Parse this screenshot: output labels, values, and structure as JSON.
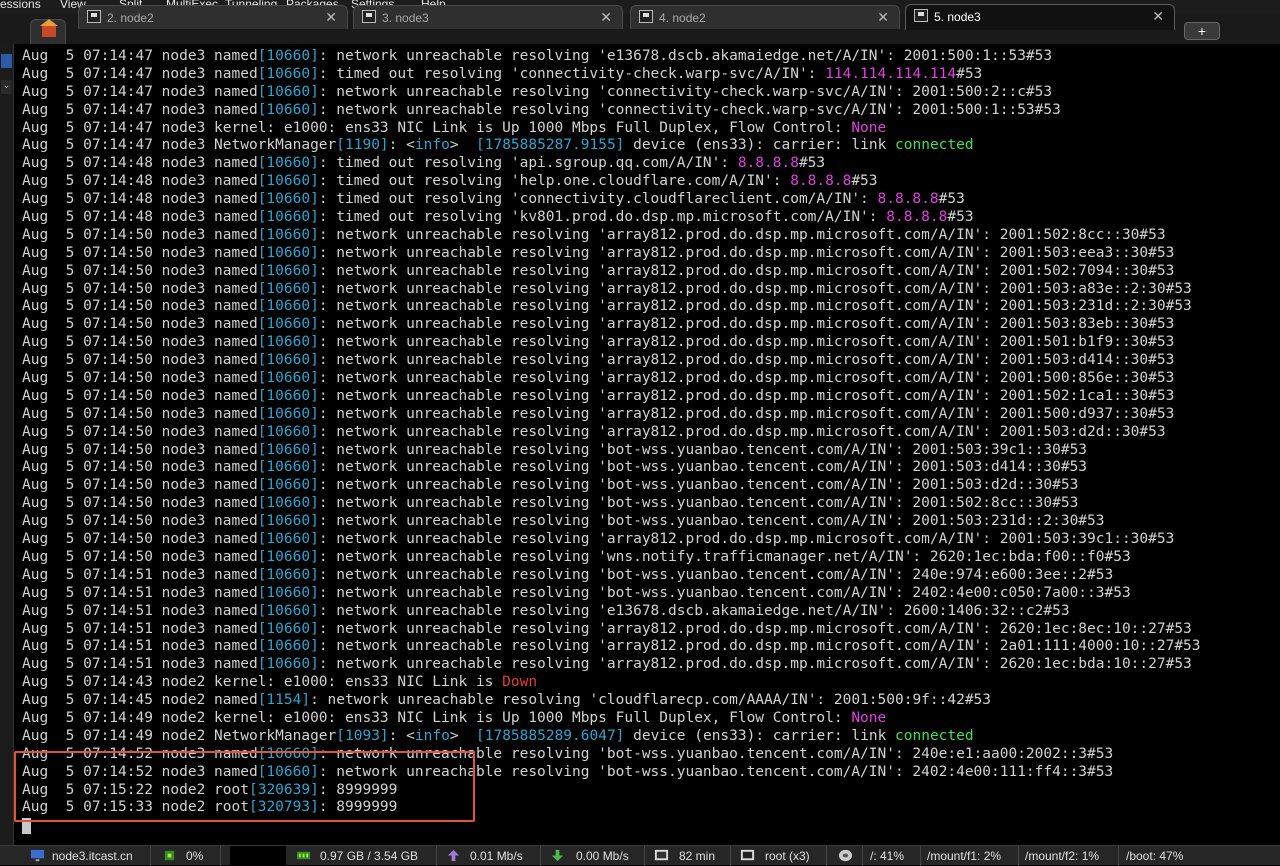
{
  "menu": [
    "essions",
    "View",
    "Split",
    "MultiExec",
    "Tunneling",
    "Packages",
    "Settings",
    "Help"
  ],
  "tabs": [
    {
      "label": "2. node2",
      "active": false
    },
    {
      "label": "3. node3",
      "active": false
    },
    {
      "label": "4. node2",
      "active": false
    },
    {
      "label": "5. node3",
      "active": true
    }
  ],
  "newtab_label": "+",
  "close_glyph": "✕",
  "colors": {
    "pid": "#2aa6d2",
    "ip": "#e040e0",
    "connected": "#3fe05a",
    "down": "#e33a3a",
    "highlight": "#e2533a",
    "text": "#d2d2d2"
  },
  "log_lines": [
    [
      [
        "Aug  5 07:14:47 node3 named",
        ""
      ],
      [
        "[10660]",
        "blue"
      ],
      [
        ": network unreachable resolving 'e13678.dscb.akamaiedge.net/A/IN': 2001:500:1::53#53",
        ""
      ]
    ],
    [
      [
        "Aug  5 07:14:47 node3 named",
        ""
      ],
      [
        "[10660]",
        "blue"
      ],
      [
        ": timed out resolving 'connectivity-check.warp-svc/A/IN': ",
        ""
      ],
      [
        "114.114.114.114",
        "mag"
      ],
      [
        "#53",
        ""
      ]
    ],
    [
      [
        "Aug  5 07:14:47 node3 named",
        ""
      ],
      [
        "[10660]",
        "blue"
      ],
      [
        ": network unreachable resolving 'connectivity-check.warp-svc/A/IN': 2001:500:2::c#53",
        ""
      ]
    ],
    [
      [
        "Aug  5 07:14:47 node3 named",
        ""
      ],
      [
        "[10660]",
        "blue"
      ],
      [
        ": network unreachable resolving 'connectivity-check.warp-svc/A/IN': 2001:500:1::53#53",
        ""
      ]
    ],
    [
      [
        "Aug  5 07:14:47 node3 kernel: e1000: ens33 NIC Link is Up 1000 Mbps Full Duplex, Flow Control: ",
        ""
      ],
      [
        "None",
        "mag"
      ]
    ],
    [
      [
        "Aug  5 07:14:47 node3 NetworkManager",
        ""
      ],
      [
        "[1190]",
        "blue"
      ],
      [
        ": <",
        ""
      ],
      [
        "info",
        "blue"
      ],
      [
        ">  ",
        ""
      ],
      [
        "[1785885287.9155]",
        "blue"
      ],
      [
        " device (ens33): carrier: link ",
        ""
      ],
      [
        "connected",
        "grn"
      ]
    ],
    [
      [
        "Aug  5 07:14:48 node3 named",
        ""
      ],
      [
        "[10660]",
        "blue"
      ],
      [
        ": timed out resolving 'api.sgroup.qq.com/A/IN': ",
        ""
      ],
      [
        "8.8.8.8",
        "mag"
      ],
      [
        "#53",
        ""
      ]
    ],
    [
      [
        "Aug  5 07:14:48 node3 named",
        ""
      ],
      [
        "[10660]",
        "blue"
      ],
      [
        ": timed out resolving 'help.one.cloudflare.com/A/IN': ",
        ""
      ],
      [
        "8.8.8.8",
        "mag"
      ],
      [
        "#53",
        ""
      ]
    ],
    [
      [
        "Aug  5 07:14:48 node3 named",
        ""
      ],
      [
        "[10660]",
        "blue"
      ],
      [
        ": timed out resolving 'connectivity.cloudflareclient.com/A/IN': ",
        ""
      ],
      [
        "8.8.8.8",
        "mag"
      ],
      [
        "#53",
        ""
      ]
    ],
    [
      [
        "Aug  5 07:14:48 node3 named",
        ""
      ],
      [
        "[10660]",
        "blue"
      ],
      [
        ": timed out resolving 'kv801.prod.do.dsp.mp.microsoft.com/A/IN': ",
        ""
      ],
      [
        "8.8.8.8",
        "mag"
      ],
      [
        "#53",
        ""
      ]
    ],
    [
      [
        "Aug  5 07:14:50 node3 named",
        ""
      ],
      [
        "[10660]",
        "blue"
      ],
      [
        ": network unreachable resolving 'array812.prod.do.dsp.mp.microsoft.com/A/IN': 2001:502:8cc::30#53",
        ""
      ]
    ],
    [
      [
        "Aug  5 07:14:50 node3 named",
        ""
      ],
      [
        "[10660]",
        "blue"
      ],
      [
        ": network unreachable resolving 'array812.prod.do.dsp.mp.microsoft.com/A/IN': 2001:503:eea3::30#53",
        ""
      ]
    ],
    [
      [
        "Aug  5 07:14:50 node3 named",
        ""
      ],
      [
        "[10660]",
        "blue"
      ],
      [
        ": network unreachable resolving 'array812.prod.do.dsp.mp.microsoft.com/A/IN': 2001:502:7094::30#53",
        ""
      ]
    ],
    [
      [
        "Aug  5 07:14:50 node3 named",
        ""
      ],
      [
        "[10660]",
        "blue"
      ],
      [
        ": network unreachable resolving 'array812.prod.do.dsp.mp.microsoft.com/A/IN': 2001:503:a83e::2:30#53",
        ""
      ]
    ],
    [
      [
        "Aug  5 07:14:50 node3 named",
        ""
      ],
      [
        "[10660]",
        "blue"
      ],
      [
        ": network unreachable resolving 'array812.prod.do.dsp.mp.microsoft.com/A/IN': 2001:503:231d::2:30#53",
        ""
      ]
    ],
    [
      [
        "Aug  5 07:14:50 node3 named",
        ""
      ],
      [
        "[10660]",
        "blue"
      ],
      [
        ": network unreachable resolving 'array812.prod.do.dsp.mp.microsoft.com/A/IN': 2001:503:83eb::30#53",
        ""
      ]
    ],
    [
      [
        "Aug  5 07:14:50 node3 named",
        ""
      ],
      [
        "[10660]",
        "blue"
      ],
      [
        ": network unreachable resolving 'array812.prod.do.dsp.mp.microsoft.com/A/IN': 2001:501:b1f9::30#53",
        ""
      ]
    ],
    [
      [
        "Aug  5 07:14:50 node3 named",
        ""
      ],
      [
        "[10660]",
        "blue"
      ],
      [
        ": network unreachable resolving 'array812.prod.do.dsp.mp.microsoft.com/A/IN': 2001:503:d414::30#53",
        ""
      ]
    ],
    [
      [
        "Aug  5 07:14:50 node3 named",
        ""
      ],
      [
        "[10660]",
        "blue"
      ],
      [
        ": network unreachable resolving 'array812.prod.do.dsp.mp.microsoft.com/A/IN': 2001:500:856e::30#53",
        ""
      ]
    ],
    [
      [
        "Aug  5 07:14:50 node3 named",
        ""
      ],
      [
        "[10660]",
        "blue"
      ],
      [
        ": network unreachable resolving 'array812.prod.do.dsp.mp.microsoft.com/A/IN': 2001:502:1ca1::30#53",
        ""
      ]
    ],
    [
      [
        "Aug  5 07:14:50 node3 named",
        ""
      ],
      [
        "[10660]",
        "blue"
      ],
      [
        ": network unreachable resolving 'array812.prod.do.dsp.mp.microsoft.com/A/IN': 2001:500:d937::30#53",
        ""
      ]
    ],
    [
      [
        "Aug  5 07:14:50 node3 named",
        ""
      ],
      [
        "[10660]",
        "blue"
      ],
      [
        ": network unreachable resolving 'array812.prod.do.dsp.mp.microsoft.com/A/IN': 2001:503:d2d::30#53",
        ""
      ]
    ],
    [
      [
        "Aug  5 07:14:50 node3 named",
        ""
      ],
      [
        "[10660]",
        "blue"
      ],
      [
        ": network unreachable resolving 'bot-wss.yuanbao.tencent.com/A/IN': 2001:503:39c1::30#53",
        ""
      ]
    ],
    [
      [
        "Aug  5 07:14:50 node3 named",
        ""
      ],
      [
        "[10660]",
        "blue"
      ],
      [
        ": network unreachable resolving 'bot-wss.yuanbao.tencent.com/A/IN': 2001:503:d414::30#53",
        ""
      ]
    ],
    [
      [
        "Aug  5 07:14:50 node3 named",
        ""
      ],
      [
        "[10660]",
        "blue"
      ],
      [
        ": network unreachable resolving 'bot-wss.yuanbao.tencent.com/A/IN': 2001:503:d2d::30#53",
        ""
      ]
    ],
    [
      [
        "Aug  5 07:14:50 node3 named",
        ""
      ],
      [
        "[10660]",
        "blue"
      ],
      [
        ": network unreachable resolving 'bot-wss.yuanbao.tencent.com/A/IN': 2001:502:8cc::30#53",
        ""
      ]
    ],
    [
      [
        "Aug  5 07:14:50 node3 named",
        ""
      ],
      [
        "[10660]",
        "blue"
      ],
      [
        ": network unreachable resolving 'bot-wss.yuanbao.tencent.com/A/IN': 2001:503:231d::2:30#53",
        ""
      ]
    ],
    [
      [
        "Aug  5 07:14:50 node3 named",
        ""
      ],
      [
        "[10660]",
        "blue"
      ],
      [
        ": network unreachable resolving 'array812.prod.do.dsp.mp.microsoft.com/A/IN': 2001:503:39c1::30#53",
        ""
      ]
    ],
    [
      [
        "Aug  5 07:14:50 node3 named",
        ""
      ],
      [
        "[10660]",
        "blue"
      ],
      [
        ": network unreachable resolving 'wns.notify.trafficmanager.net/A/IN': 2620:1ec:bda:f00::f0#53",
        ""
      ]
    ],
    [
      [
        "Aug  5 07:14:51 node3 named",
        ""
      ],
      [
        "[10660]",
        "blue"
      ],
      [
        ": network unreachable resolving 'bot-wss.yuanbao.tencent.com/A/IN': 240e:974:e600:3ee::2#53",
        ""
      ]
    ],
    [
      [
        "Aug  5 07:14:51 node3 named",
        ""
      ],
      [
        "[10660]",
        "blue"
      ],
      [
        ": network unreachable resolving 'bot-wss.yuanbao.tencent.com/A/IN': 2402:4e00:c050:7a00::3#53",
        ""
      ]
    ],
    [
      [
        "Aug  5 07:14:51 node3 named",
        ""
      ],
      [
        "[10660]",
        "blue"
      ],
      [
        ": network unreachable resolving 'e13678.dscb.akamaiedge.net/A/IN': 2600:1406:32::c2#53",
        ""
      ]
    ],
    [
      [
        "Aug  5 07:14:51 node3 named",
        ""
      ],
      [
        "[10660]",
        "blue"
      ],
      [
        ": network unreachable resolving 'array812.prod.do.dsp.mp.microsoft.com/A/IN': 2620:1ec:8ec:10::27#53",
        ""
      ]
    ],
    [
      [
        "Aug  5 07:14:51 node3 named",
        ""
      ],
      [
        "[10660]",
        "blue"
      ],
      [
        ": network unreachable resolving 'array812.prod.do.dsp.mp.microsoft.com/A/IN': 2a01:111:4000:10::27#53",
        ""
      ]
    ],
    [
      [
        "Aug  5 07:14:51 node3 named",
        ""
      ],
      [
        "[10660]",
        "blue"
      ],
      [
        ": network unreachable resolving 'array812.prod.do.dsp.mp.microsoft.com/A/IN': 2620:1ec:bda:10::27#53",
        ""
      ]
    ],
    [
      [
        "Aug  5 07:14:43 node2 kernel: e1000: ens33 NIC Link is ",
        ""
      ],
      [
        "Down",
        "red"
      ]
    ],
    [
      [
        "Aug  5 07:14:45 node2 named",
        ""
      ],
      [
        "[1154]",
        "blue"
      ],
      [
        ": network unreachable resolving 'cloudflarecp.com/AAAA/IN': 2001:500:9f::42#53",
        ""
      ]
    ],
    [
      [
        "Aug  5 07:14:49 node2 kernel: e1000: ens33 NIC Link is Up 1000 Mbps Full Duplex, Flow Control: ",
        ""
      ],
      [
        "None",
        "mag"
      ]
    ],
    [
      [
        "Aug  5 07:14:49 node2 NetworkManager",
        ""
      ],
      [
        "[1093]",
        "blue"
      ],
      [
        ": <",
        ""
      ],
      [
        "info",
        "blue"
      ],
      [
        ">  ",
        ""
      ],
      [
        "[1785885289.6047]",
        "blue"
      ],
      [
        " device (ens33): carrier: link ",
        ""
      ],
      [
        "connected",
        "grn"
      ]
    ],
    [
      [
        "Aug  5 07:14:52 node3 named",
        ""
      ],
      [
        "[10660]",
        "blue"
      ],
      [
        ": network unreachable resolving 'bot-wss.yuanbao.tencent.com/A/IN': 240e:e1:aa00:2002::3#53",
        ""
      ]
    ],
    [
      [
        "Aug  5 07:14:52 node3 named",
        ""
      ],
      [
        "[10660]",
        "blue"
      ],
      [
        ": network unreachable resolving 'bot-wss.yuanbao.tencent.com/A/IN': 2402:4e00:111:ff4::3#53",
        ""
      ]
    ],
    [
      [
        "Aug  5 07:15:22 node2 root",
        ""
      ],
      [
        "[320639]",
        "blue"
      ],
      [
        ": 8999999",
        ""
      ]
    ],
    [
      [
        "Aug  5 07:15:33 node2 root",
        ""
      ],
      [
        "[320793]",
        "blue"
      ],
      [
        ": 8999999",
        ""
      ]
    ]
  ],
  "status": {
    "host": "node3.itcast.cn",
    "cpu": "0%",
    "memory": "0.97 GB / 3.54 GB",
    "upload": "0.01 Mb/s",
    "download": "0.00 Mb/s",
    "uptime": "82 min",
    "users": "root (x3)",
    "disk_root": "/: 41%",
    "disk_f1": "/mount/f1: 2%",
    "disk_f2": "/mount/f2: 1%",
    "disk_boot": "/boot: 47%"
  },
  "icons": [
    "home-icon",
    "terminal-icon",
    "close-icon",
    "plus-icon",
    "monitor-icon",
    "cpu-icon",
    "memory-icon",
    "upload-icon",
    "download-icon",
    "clock-icon",
    "user-icon",
    "disk-icon"
  ]
}
